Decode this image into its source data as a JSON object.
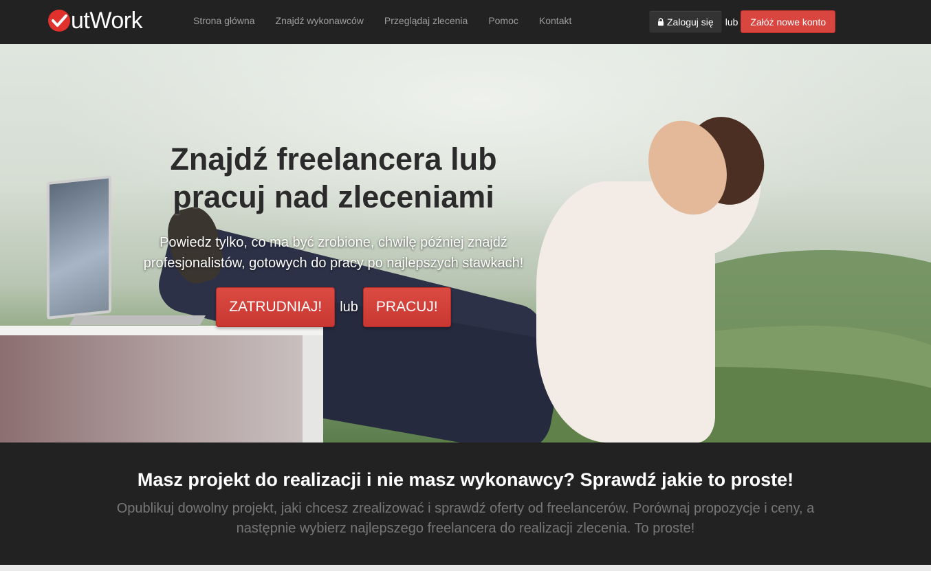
{
  "brand": {
    "logo_text": "utWork"
  },
  "nav": {
    "links": [
      "Strona główna",
      "Znajdź wykonawców",
      "Przeglądaj zlecenia",
      "Pomoc",
      "Kontakt"
    ],
    "login_label": "Zaloguj się",
    "or_label": "lub",
    "register_label": "Załóż nowe konto"
  },
  "hero": {
    "title_line1": "Znajdź freelancera lub",
    "title_line2": "pracuj nad zleceniami",
    "subtitle_line1": "Powiedz tylko, co ma być zrobione, chwilę później znajdź",
    "subtitle_line2": "profesjonalistów, gotowych do pracy po najlepszych stawkach!",
    "hire_label": "ZATRUDNIAJ!",
    "or_label": "lub",
    "work_label": "PRACUJ!"
  },
  "info": {
    "title": "Masz projekt do realizacji i nie masz wykonawcy? Sprawdź jakie to proste!",
    "text_line1": "Opublikuj dowolny projekt, jaki chcesz zrealizować i sprawdź oferty od freelancerów. Porównaj propozycje i ceny, a",
    "text_line2": "następnie wybierz najlepszego freelancera do realizacji zlecenia. To proste!"
  },
  "colors": {
    "accent": "#d9463f",
    "navbar": "#222222"
  }
}
